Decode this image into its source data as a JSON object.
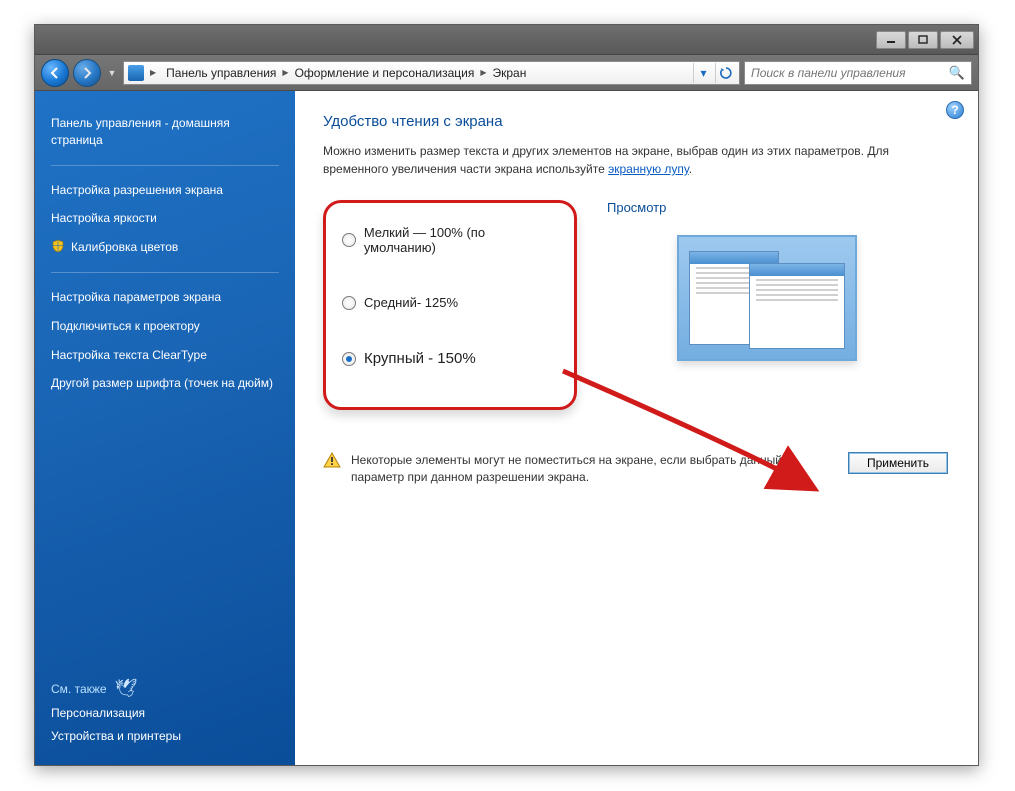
{
  "breadcrumb": {
    "seg1": "Панель управления",
    "seg2": "Оформление и персонализация",
    "seg3": "Экран"
  },
  "search": {
    "placeholder": "Поиск в панели управления"
  },
  "sidebar": {
    "home": "Панель управления - домашняя страница",
    "links": [
      "Настройка разрешения экрана",
      "Настройка яркости",
      "Калибровка цветов",
      "Настройка параметров экрана",
      "Подключиться к проектору",
      "Настройка текста ClearType",
      "Другой размер шрифта (точек на дюйм)"
    ],
    "see_also_title": "См. также",
    "see_also": [
      "Персонализация",
      "Устройства и принтеры"
    ]
  },
  "content": {
    "title": "Удобство чтения с экрана",
    "desc_pre": "Можно изменить размер текста и других элементов на экране, выбрав один из этих параметров. Для временного увеличения части экрана используйте ",
    "desc_link": "экранную лупу",
    "desc_post": ".",
    "options": {
      "small": "Мелкий — 100% (по умолчанию)",
      "medium": "Средний- 125%",
      "large": "Крупный - 150%"
    },
    "preview_label": "Просмотр",
    "warning": "Некоторые элементы могут не поместиться на экране, если выбрать данный параметр при данном разрешении экрана.",
    "apply": "Применить"
  }
}
